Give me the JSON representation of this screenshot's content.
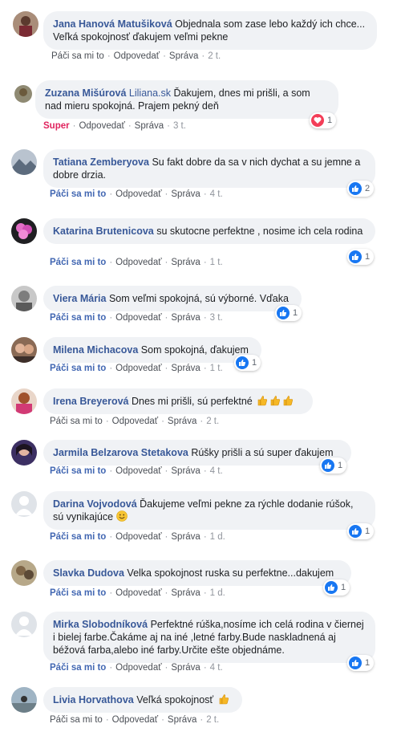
{
  "comments": [
    {
      "author": "Jana Hanová Matušiková",
      "text": "Objednala som zase lebo každý ich chce... Veľká spokojnosť ďakujem veľmi pekne",
      "like_label": "Páči sa mi to",
      "reply_label": "Odpovedať",
      "message_label": "Správa",
      "time": "2 t."
    },
    {
      "author": "Zuzana Mišúrová",
      "brand": "Liliana.sk",
      "text": "Ďakujem, dnes mi prišli, a som nad mieru spokojná. Prajem pekný deň",
      "like_label": "Super",
      "reply_label": "Odpovedať",
      "message_label": "Správa",
      "time": "3 t.",
      "reaction": {
        "type": "love",
        "count": "1"
      }
    },
    {
      "author": "Tatiana Zemberyova",
      "text": "Su fakt dobre da sa v nich dychat a su jemne a dobre drzia.",
      "like_label": "Páči sa mi to",
      "reply_label": "Odpovedať",
      "message_label": "Správa",
      "time": "4 t.",
      "reaction": {
        "type": "like",
        "count": "2"
      }
    },
    {
      "author": "Katarina Brutenicova",
      "text": "su skutocne perfektne , nosime ich cela rodina",
      "like_label": "Páči sa mi to",
      "reply_label": "Odpovedať",
      "message_label": "Správa",
      "time": "1 t.",
      "reaction": {
        "type": "like",
        "count": "1"
      }
    },
    {
      "author": "Viera Mária",
      "text": "Som veľmi spokojná, sú výborné. Vďaka",
      "like_label": "Páči sa mi to",
      "reply_label": "Odpovedať",
      "message_label": "Správa",
      "time": "3 t.",
      "reaction": {
        "type": "like",
        "count": "1"
      }
    },
    {
      "author": "Milena Michacova",
      "text": "Som spokojná, ďakujem",
      "like_label": "Páči sa mi to",
      "reply_label": "Odpovedať",
      "message_label": "Správa",
      "time": "1 t.",
      "reaction": {
        "type": "like",
        "count": "1"
      }
    },
    {
      "author": "Irena Breyerová",
      "text": "Dnes mi prišli, sú perfektné",
      "like_label": "Páči sa mi to",
      "reply_label": "Odpovedať",
      "message_label": "Správa",
      "time": "2 t."
    },
    {
      "author": "Jarmila Belzarova Stetakova",
      "text": "Rúšky prišli a sú super ďakujem",
      "like_label": "Páči sa mi to",
      "reply_label": "Odpovedať",
      "message_label": "Správa",
      "time": "4 t.",
      "reaction": {
        "type": "like",
        "count": "1"
      }
    },
    {
      "author": "Darina Vojvodová",
      "text": "Ďakujeme veľmi pekne za rýchle dodanie rúšok, sú vynikajúce",
      "like_label": "Páči sa mi to",
      "reply_label": "Odpovedať",
      "message_label": "Správa",
      "time": "1 d.",
      "reaction": {
        "type": "like",
        "count": "1"
      }
    },
    {
      "author": "Slavka Dudova",
      "text": "Velka spokojnost ruska su perfektne...dakujem",
      "like_label": "Páči sa mi to",
      "reply_label": "Odpovedať",
      "message_label": "Správa",
      "time": "1 d.",
      "reaction": {
        "type": "like",
        "count": "1"
      }
    },
    {
      "author": "Mirka Slobodníková",
      "text": "Perfektné rúška,nosíme ich celá rodina v čiernej i bielej farbe.Čakáme aj na iné ,letné farby.Bude naskladnená aj béžová farba,alebo iné farby.Určite ešte objednáme.",
      "like_label": "Páči sa mi to",
      "reply_label": "Odpovedať",
      "message_label": "Správa",
      "time": "4 t.",
      "reaction": {
        "type": "like",
        "count": "1"
      }
    },
    {
      "author": "Livia Horvathova",
      "text": "Veľká spokojnosť",
      "like_label": "Páči sa mi to",
      "reply_label": "Odpovedať",
      "message_label": "Správa",
      "time": "2 t."
    }
  ]
}
